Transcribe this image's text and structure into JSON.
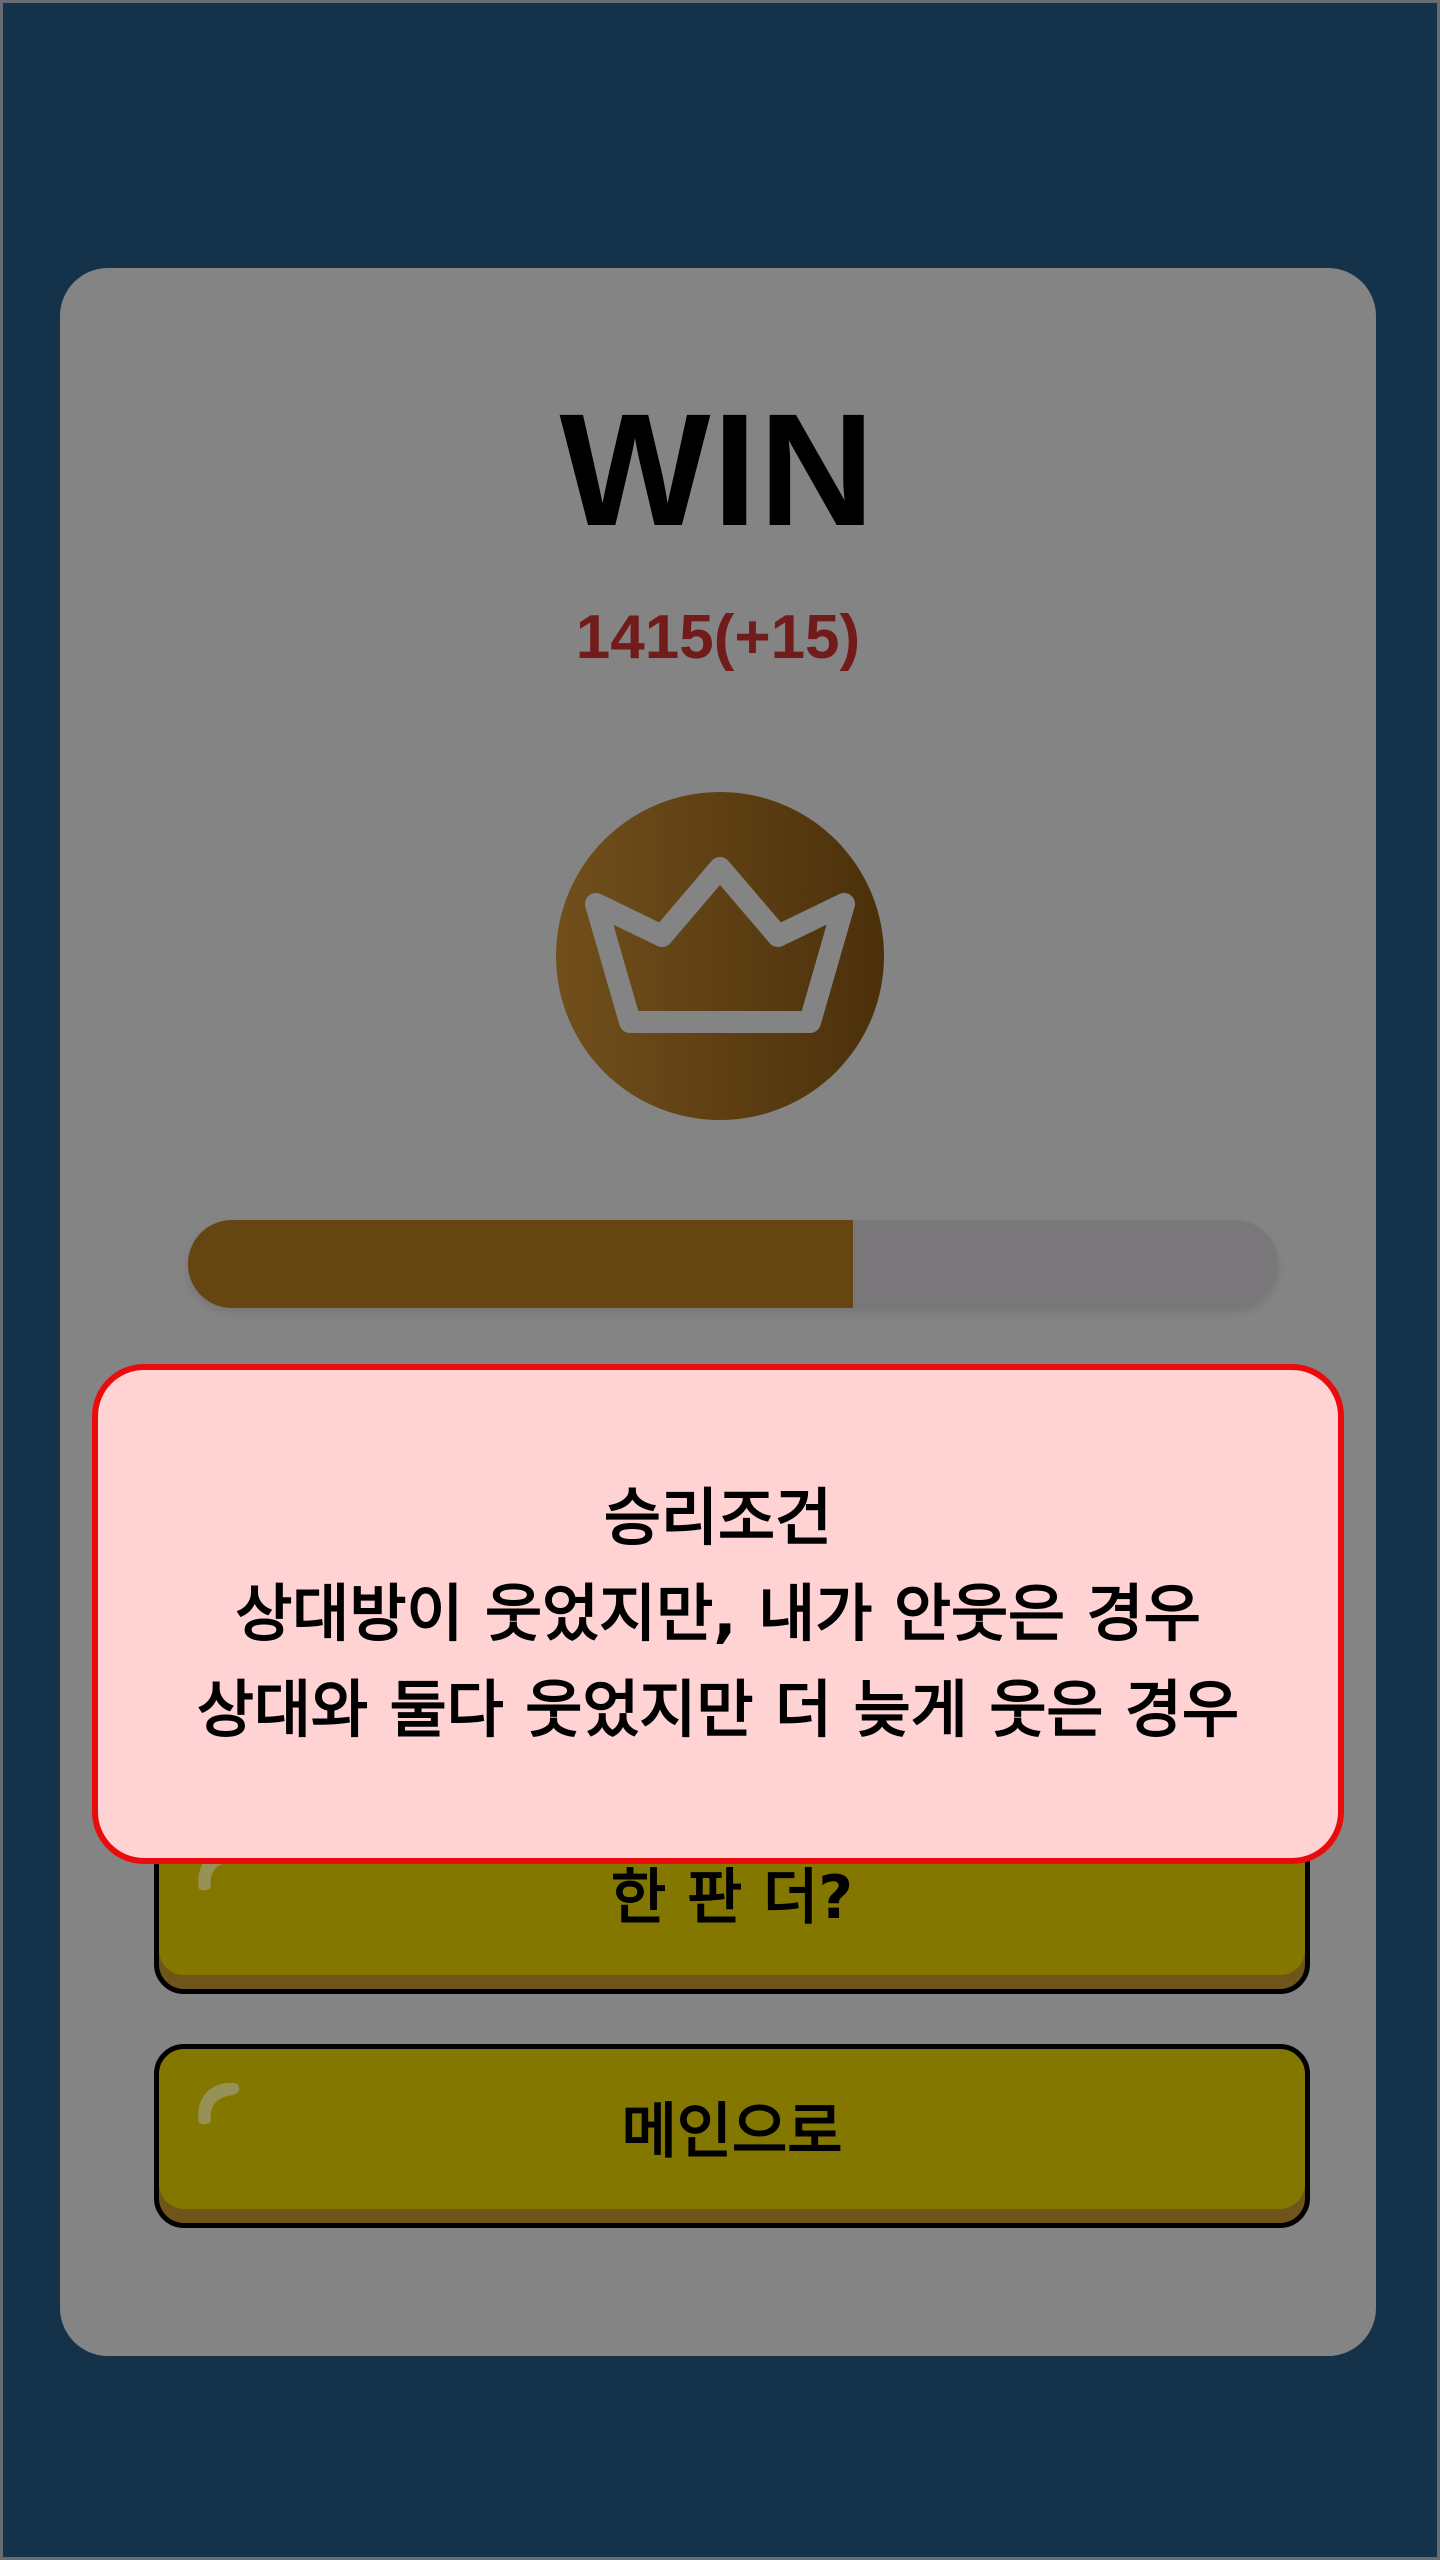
{
  "result": {
    "title": "WIN",
    "score_text": "1415(+15)",
    "rank_icon": "crown-icon",
    "progress": 0.61
  },
  "buttons": {
    "play_again_label": "한 판 더?",
    "main_menu_label": "메인으로"
  },
  "popup": {
    "heading": "승리조건",
    "line1": "상대방이 웃었지만, 내가 안웃은 경우",
    "line2": "상대와 둘다 웃었지만 더 늦게 웃은 경우"
  },
  "colors": {
    "background": "#23517a",
    "score": "#b82c2c",
    "badge_gold": "#a4701e",
    "button_yellow": "#d6c000",
    "popup_border": "#ea0c0c",
    "popup_fill": "#ffd2d4"
  }
}
